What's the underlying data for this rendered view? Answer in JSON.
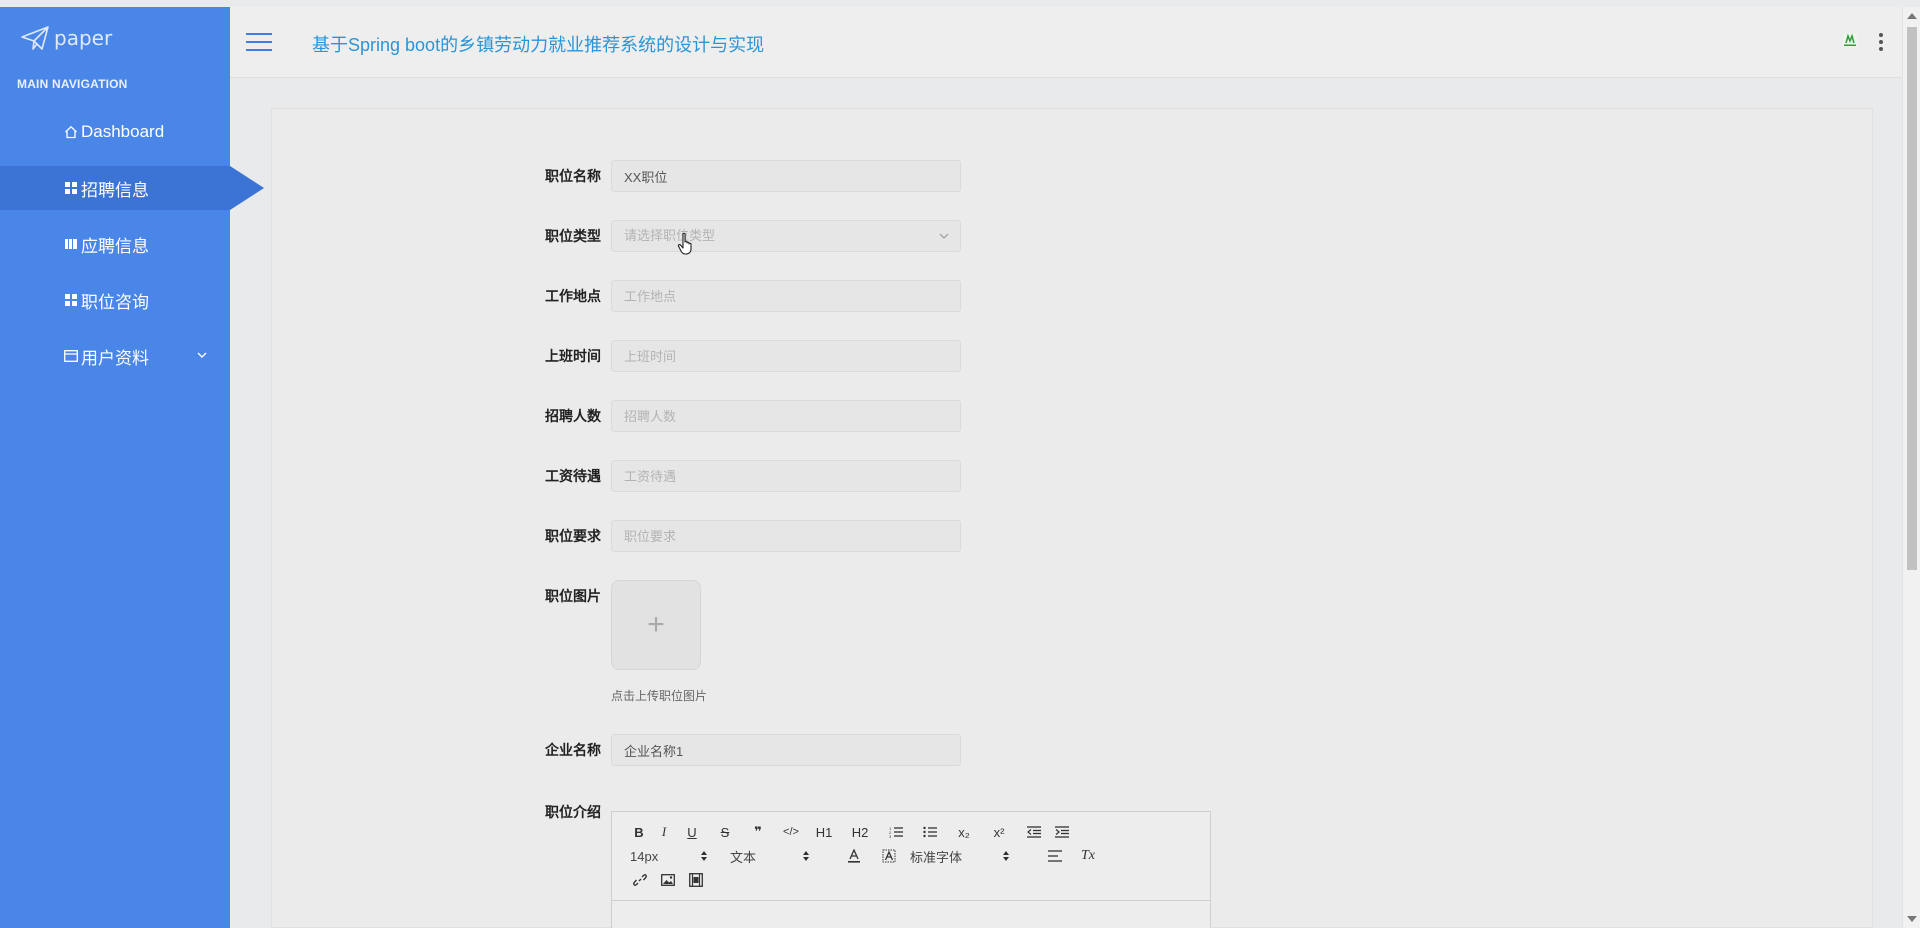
{
  "sidebar": {
    "logo_text": "paper",
    "nav_heading": "MAIN NAVIGATION",
    "items": [
      {
        "label": "Dashboard",
        "icon": "home-icon"
      },
      {
        "label": "招聘信息",
        "icon": "grid-icon",
        "active": true
      },
      {
        "label": "应聘信息",
        "icon": "book-icon"
      },
      {
        "label": "职位咨询",
        "icon": "grid-icon"
      },
      {
        "label": "用户资料",
        "icon": "card-icon",
        "has_submenu": true
      }
    ],
    "colors": {
      "background": "#4a86e8",
      "active": "#3c74d6"
    }
  },
  "header": {
    "title": "基于Spring boot的乡镇劳动力就业推荐系统的设计与实现",
    "title_color": "#2a95d9"
  },
  "form": {
    "job_name": {
      "label": "职位名称",
      "value": "XX职位"
    },
    "job_type": {
      "label": "职位类型",
      "placeholder": "请选择职位类型"
    },
    "work_location": {
      "label": "工作地点",
      "placeholder": "工作地点"
    },
    "work_time": {
      "label": "上班时间",
      "placeholder": "上班时间"
    },
    "headcount": {
      "label": "招聘人数",
      "placeholder": "招聘人数"
    },
    "salary": {
      "label": "工资待遇",
      "placeholder": "工资待遇"
    },
    "requirements": {
      "label": "职位要求",
      "placeholder": "职位要求"
    },
    "job_image": {
      "label": "职位图片",
      "upload_symbol": "+",
      "hint": "点击上传职位图片"
    },
    "company_name": {
      "label": "企业名称",
      "value": "企业名称1"
    },
    "job_intro": {
      "label": "职位介绍"
    }
  },
  "editor": {
    "font_size": "14px",
    "header_select": "文本",
    "font_family": "标准字体",
    "buttons": {
      "bold": "B",
      "italic": "I",
      "underline": "U",
      "strike": "S",
      "quote": "❞",
      "code": "</>",
      "h1": "H1",
      "h2": "H2",
      "sub": "x₂",
      "sup": "x²",
      "clear": "Tx"
    }
  }
}
